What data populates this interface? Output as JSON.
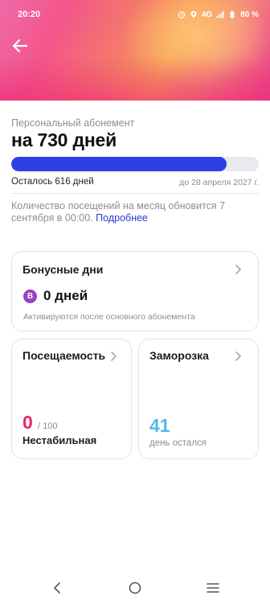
{
  "status_bar": {
    "time": "20:20",
    "network": "4G",
    "battery": "80 %"
  },
  "plan": {
    "label": "Персональный абонемент",
    "title": "на 730 дней",
    "progress_fraction": 0.87,
    "remaining": "Осталось 616 дней",
    "until": "до 28 апреля 2027 г."
  },
  "visits_note": {
    "text": "Количество посещений на месяц обновится 7 сентября в 00:00.",
    "link": "Подробнее"
  },
  "bonus": {
    "title": "Бонусные дни",
    "badge": "B",
    "days": "0 дней",
    "note": "Активируются после основного абонемента"
  },
  "attendance": {
    "title": "Посещаемость",
    "value": "0",
    "max": "/ 100",
    "status": "Нестабильная"
  },
  "freeze": {
    "title": "Заморозка",
    "value": "41",
    "label": "день остался"
  },
  "colors": {
    "accent": "#2c3fe4",
    "link": "#2a3ecf",
    "attendance": "#e8266e",
    "freeze": "#52b8e6",
    "badge": "#9b3fc8"
  },
  "icons": [
    "back-arrow-icon",
    "alarm-icon",
    "location-icon",
    "signal-icon",
    "battery-icon",
    "chevron-right-icon",
    "nav-back-icon",
    "nav-home-icon",
    "nav-menu-icon"
  ]
}
